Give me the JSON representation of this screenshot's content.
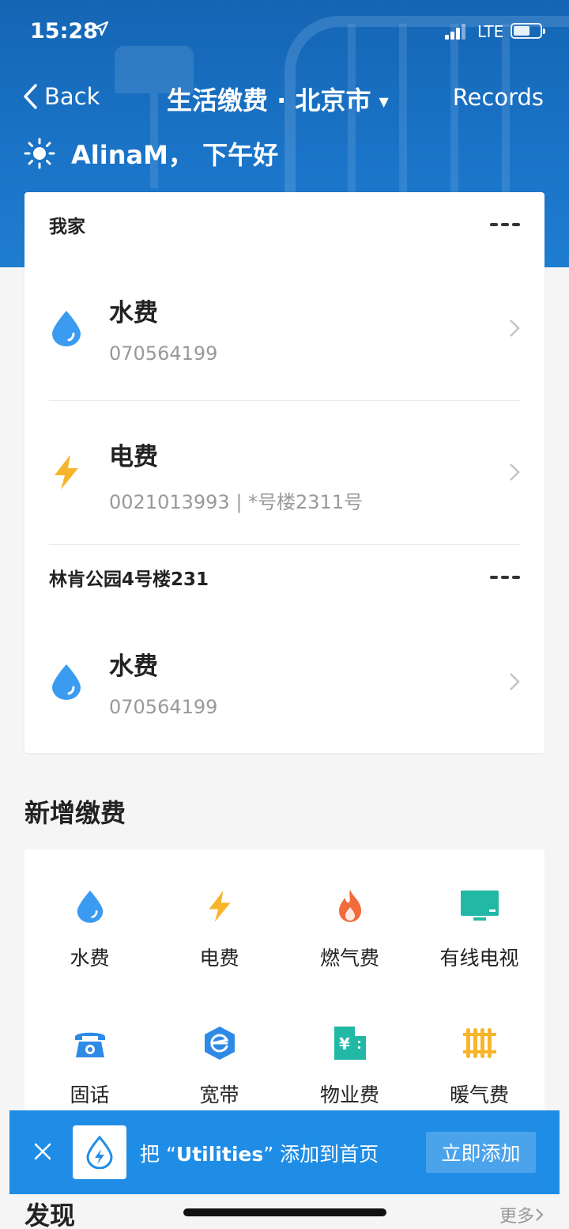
{
  "status_bar": {
    "time": "15:28",
    "network": "LTE"
  },
  "nav": {
    "back_label": "Back",
    "title": "生活缴费 · 北京市",
    "records_label": "Records"
  },
  "greeting": "AlinaM，  下午好",
  "groups": [
    {
      "name": "我家",
      "bills": [
        {
          "title": "水费",
          "sub": "070564199",
          "icon": "water-drop-icon"
        },
        {
          "title": "电费",
          "sub": "0021013993 | *号楼2311号",
          "icon": "lightning-icon"
        }
      ]
    },
    {
      "name": "林肯公园4号楼231",
      "bills": [
        {
          "title": "水费",
          "sub": "070564199",
          "icon": "water-drop-icon"
        }
      ]
    }
  ],
  "add_section": {
    "title": "新增缴费",
    "items": [
      {
        "label": "水费",
        "icon": "water-drop-icon"
      },
      {
        "label": "电费",
        "icon": "lightning-icon"
      },
      {
        "label": "燃气费",
        "icon": "flame-icon"
      },
      {
        "label": "有线电视",
        "icon": "tv-icon"
      },
      {
        "label": "固话",
        "icon": "telephone-icon"
      },
      {
        "label": "宽带",
        "icon": "broadband-icon"
      },
      {
        "label": "物业费",
        "icon": "building-icon"
      },
      {
        "label": "暖气费",
        "icon": "radiator-icon"
      }
    ]
  },
  "banner": {
    "prefix": "把 “",
    "app_name": "Utilities",
    "suffix": "” 添加到首页",
    "button_label": "立即添加"
  },
  "discover": {
    "title": "发现",
    "more_label": "更多"
  },
  "colors": {
    "brand_blue": "#1f8de6",
    "water": "#3a9bf0",
    "electric": "#f7b52c",
    "gas": "#f26b3a",
    "tv": "#21b8a6",
    "phone": "#2f8ae6"
  }
}
